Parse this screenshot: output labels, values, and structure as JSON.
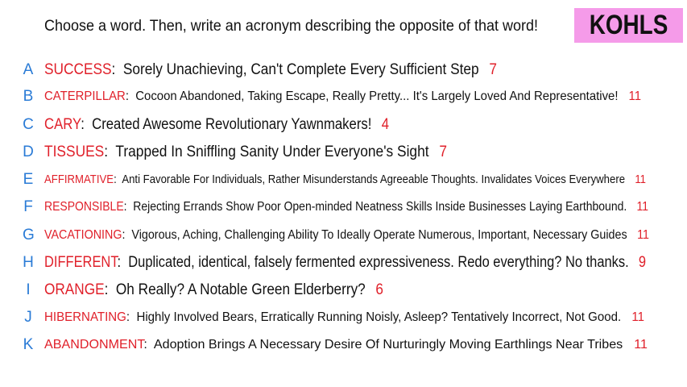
{
  "prompt": "Choose a word. Then, write an acronym describing the opposite of that word!",
  "badge": "KOHLS",
  "colors": {
    "letter": "#2a7bd6",
    "word": "#e0202a",
    "number": "#e0202a",
    "badge_bg": "#f59be9"
  },
  "items": [
    {
      "letter": "A",
      "word": "SUCCESS",
      "acronym": "Sorely Unachieving, Can't Complete Every Sufficient Step",
      "count": "7"
    },
    {
      "letter": "B",
      "word": "CATERPILLAR",
      "acronym": "Cocoon Abandoned, Taking Escape, Really Pretty... It's Largely Loved And Representative!",
      "count": "11"
    },
    {
      "letter": "C",
      "word": "CARY",
      "acronym": "Created Awesome Revolutionary Yawnmakers!",
      "count": "4"
    },
    {
      "letter": "D",
      "word": "TISSUES",
      "acronym": "Trapped In Sniffling Sanity Under Everyone's Sight",
      "count": "7"
    },
    {
      "letter": "E",
      "word": "AFFIRMATIVE",
      "acronym": "Anti Favorable For Individuals, Rather Misunderstands Agreeable Thoughts. Invalidates Voices Everywhere",
      "count": "11"
    },
    {
      "letter": "F",
      "word": "RESPONSIBLE",
      "acronym": "Rejecting Errands Show Poor Open-minded Neatness Skills Inside Businesses Laying Earthbound.",
      "count": "11"
    },
    {
      "letter": "G",
      "word": "VACATIONING",
      "acronym": "Vigorous, Aching, Challenging Ability To Ideally Operate Numerous, Important, Necessary Guides",
      "count": "11"
    },
    {
      "letter": "H",
      "word": "DIFFERENT",
      "acronym": "Duplicated, identical, falsely fermented expressiveness.  Redo everything?  No thanks.",
      "count": "9"
    },
    {
      "letter": "I",
      "word": "ORANGE",
      "acronym": "Oh Really? A Notable Green Elderberry?",
      "count": "6"
    },
    {
      "letter": "J",
      "word": "HIBERNATING",
      "acronym": "Highly Involved Bears, Erratically Running Noisly, Asleep? Tentatively Incorrect, Not Good.",
      "count": "11"
    },
    {
      "letter": "K",
      "word": "ABANDONMENT",
      "acronym": "Adoption Brings A Necessary Desire Of Nurturingly Moving Earthlings Near Tribes",
      "count": "11"
    }
  ]
}
